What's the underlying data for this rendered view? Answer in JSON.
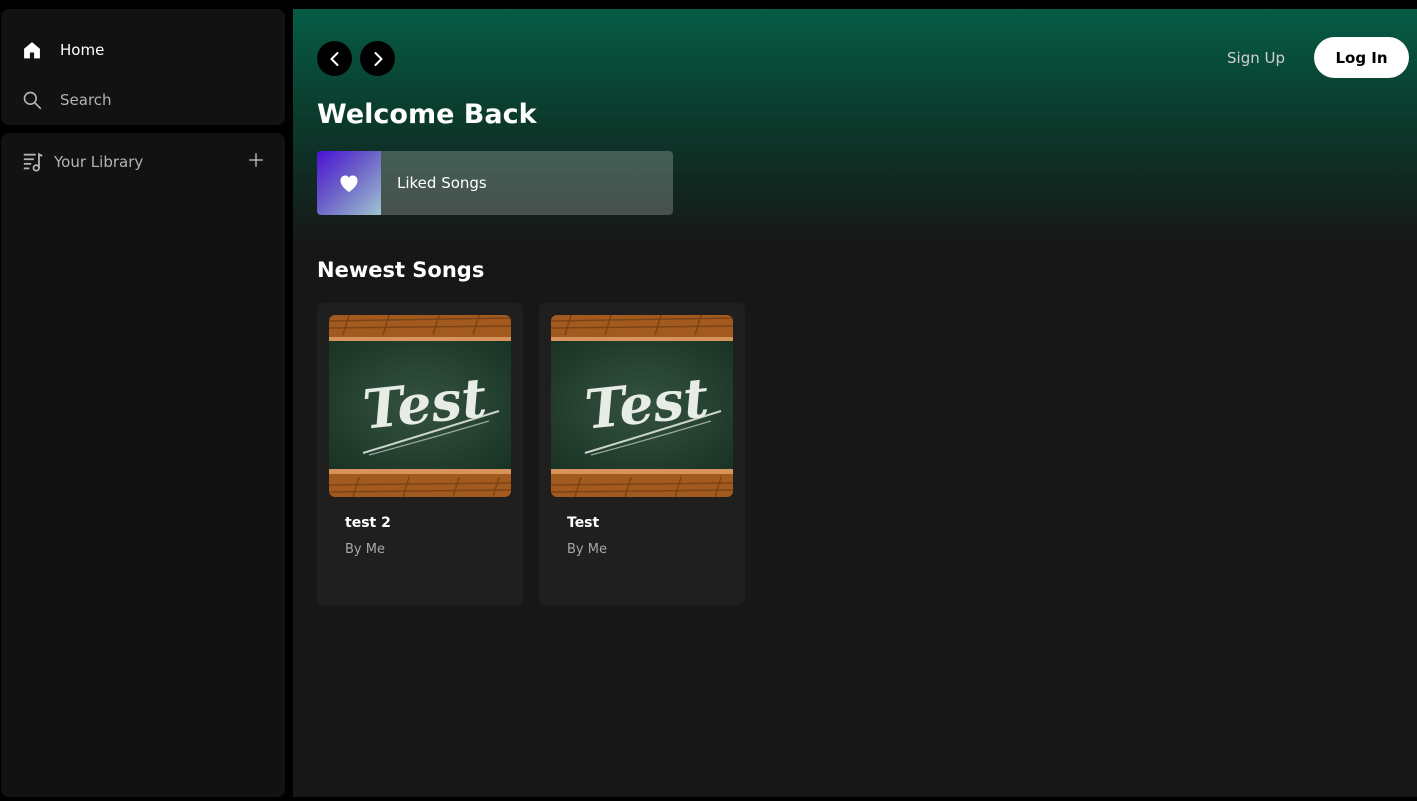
{
  "sidebar": {
    "nav": {
      "home_label": "Home",
      "home_icon": "home-icon",
      "search_label": "Search",
      "search_icon": "search-icon"
    },
    "library": {
      "label": "Your Library",
      "icon": "library-icon",
      "add_icon": "plus-icon"
    }
  },
  "header": {
    "back_icon": "chevron-left-icon",
    "forward_icon": "chevron-right-icon",
    "signup_label": "Sign Up",
    "login_label": "Log In"
  },
  "main": {
    "greeting": "Welcome Back",
    "liked_songs": {
      "label": "Liked Songs",
      "icon": "heart-icon"
    },
    "newest": {
      "title": "Newest Songs",
      "songs": [
        {
          "title": "test 2",
          "author": "By Me",
          "cover_text": "Test"
        },
        {
          "title": "Test",
          "author": "By Me",
          "cover_text": "Test"
        }
      ]
    }
  },
  "colors": {
    "background": "#000000",
    "panel": "#121212",
    "main_bg": "#171717",
    "header_gradient_top": "#065c45",
    "card": "#1f1f1f",
    "muted_text": "#b3b3b3"
  }
}
